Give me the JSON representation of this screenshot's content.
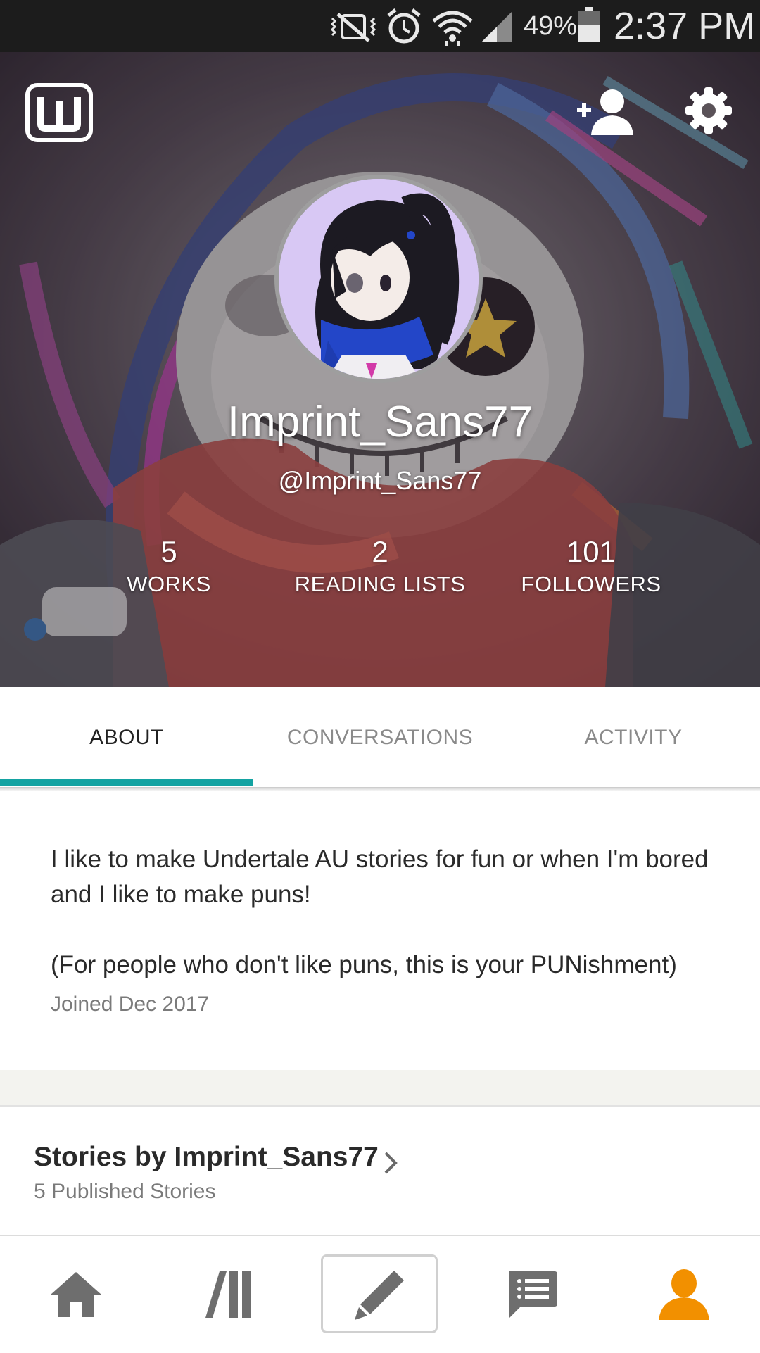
{
  "status_bar": {
    "battery_percent": "49%",
    "time": "2:37 PM",
    "icons": [
      "vibrate-mute-icon",
      "alarm-icon",
      "wifi-icon",
      "signal-icon",
      "battery-icon"
    ]
  },
  "header": {
    "logo_icon": "wattpad-logo-icon",
    "actions": [
      "add-friend-icon",
      "gear-icon"
    ],
    "display_name": "Imprint_Sans77",
    "username": "@Imprint_Sans77",
    "stats": [
      {
        "value": "5",
        "label": "WORKS"
      },
      {
        "value": "2",
        "label": "READING LISTS"
      },
      {
        "value": "101",
        "label": "FOLLOWERS"
      }
    ]
  },
  "tabs": [
    {
      "label": "ABOUT",
      "active": true
    },
    {
      "label": "CONVERSATIONS",
      "active": false
    },
    {
      "label": "ACTIVITY",
      "active": false
    }
  ],
  "about": {
    "bio": "I like to make Undertale AU stories for fun or when I'm bored and I like to make puns!\n\n(For people who don't like puns, this is your PUNishment)",
    "joined": "Joined Dec 2017"
  },
  "stories": {
    "title": "Stories by Imprint_Sans77",
    "count": "5 Published Stories"
  },
  "bottom_nav": [
    "home-icon",
    "library-icon",
    "write-icon",
    "messages-icon",
    "profile-icon"
  ],
  "colors": {
    "accent_teal": "#14a3a2",
    "profile_orange": "#f29000",
    "status_bar": "#1c1c1c",
    "nav_grey": "#6e6e6e"
  }
}
